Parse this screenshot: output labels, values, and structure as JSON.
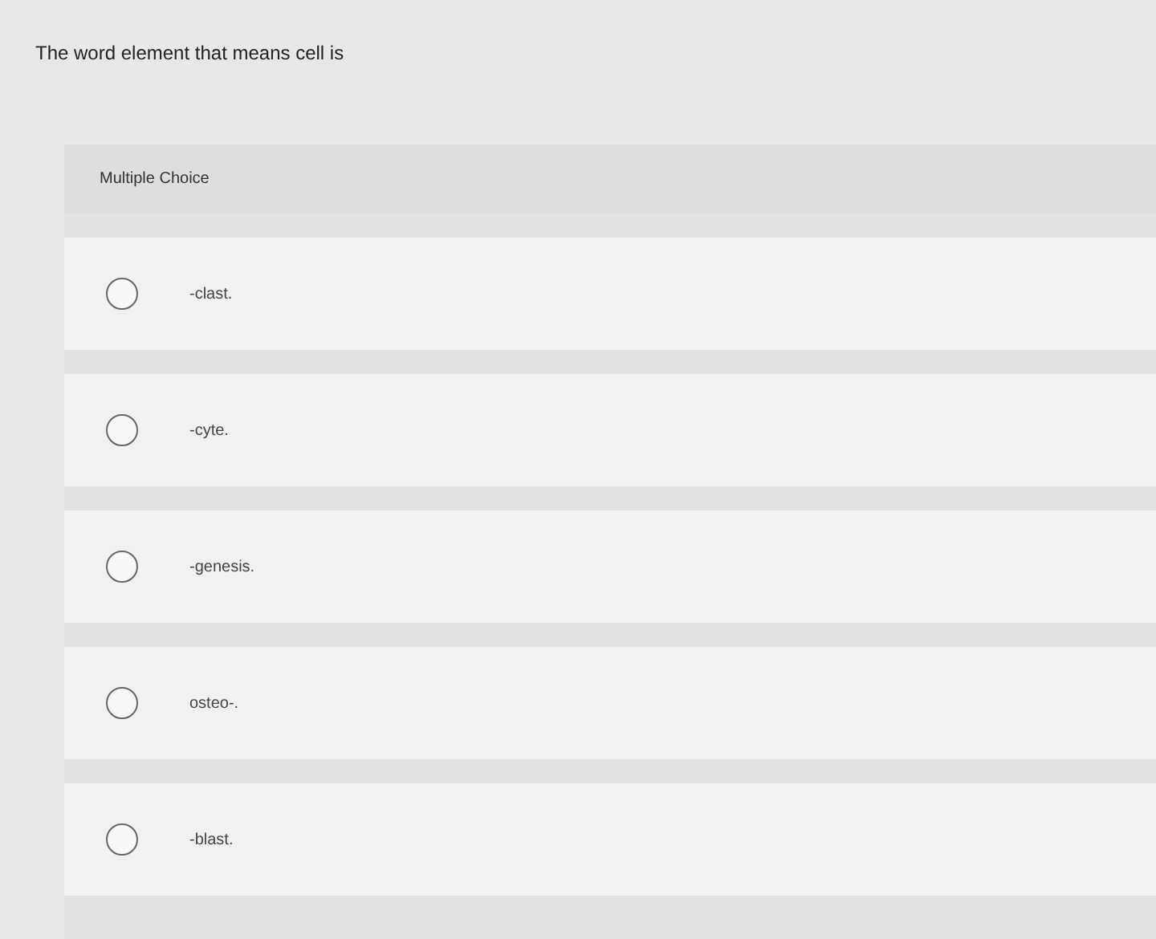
{
  "question": "The word element that means cell is",
  "section": {
    "title": "Multiple Choice"
  },
  "options": [
    {
      "label": "-clast.",
      "selected": false
    },
    {
      "label": "-cyte.",
      "selected": false
    },
    {
      "label": "-genesis.",
      "selected": false
    },
    {
      "label": "osteo-.",
      "selected": false
    },
    {
      "label": "-blast.",
      "selected": false
    }
  ]
}
